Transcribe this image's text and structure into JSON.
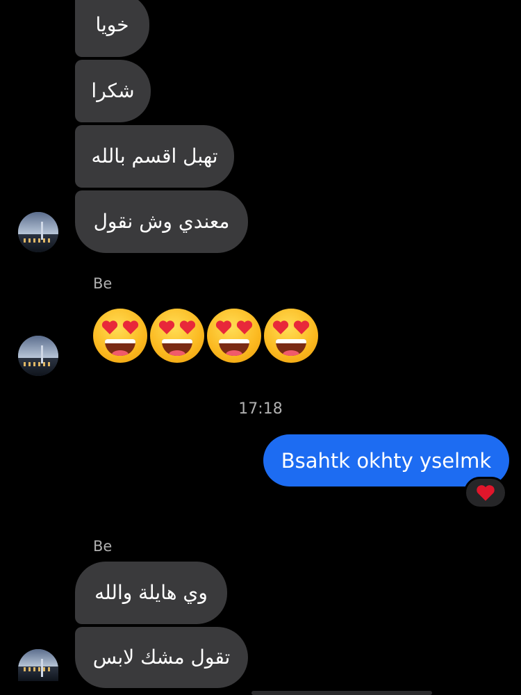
{
  "chat": {
    "messages_top": [
      {
        "text": "خويا"
      },
      {
        "text": "شكرا"
      },
      {
        "text": "تهبل اقسم بالله"
      },
      {
        "text": "معندي وش نقول"
      }
    ],
    "sender_name_1": "Be",
    "emoji_message": {
      "emoji": "smiling-face-with-heart-eyes",
      "count": 4
    },
    "timestamp": "17:18",
    "outgoing": {
      "text": "Bsahtk okhty yselmk",
      "reaction": "red-heart"
    },
    "sender_name_2": "Be",
    "messages_bottom": [
      {
        "text": "وي هايلة والله"
      },
      {
        "text": "تقول مشك لابس"
      }
    ]
  },
  "colors": {
    "background": "#000000",
    "incoming_bubble": "#3a3a3c",
    "outgoing_bubble": "#1d6cf2",
    "reaction_heart": "#e0162b"
  }
}
